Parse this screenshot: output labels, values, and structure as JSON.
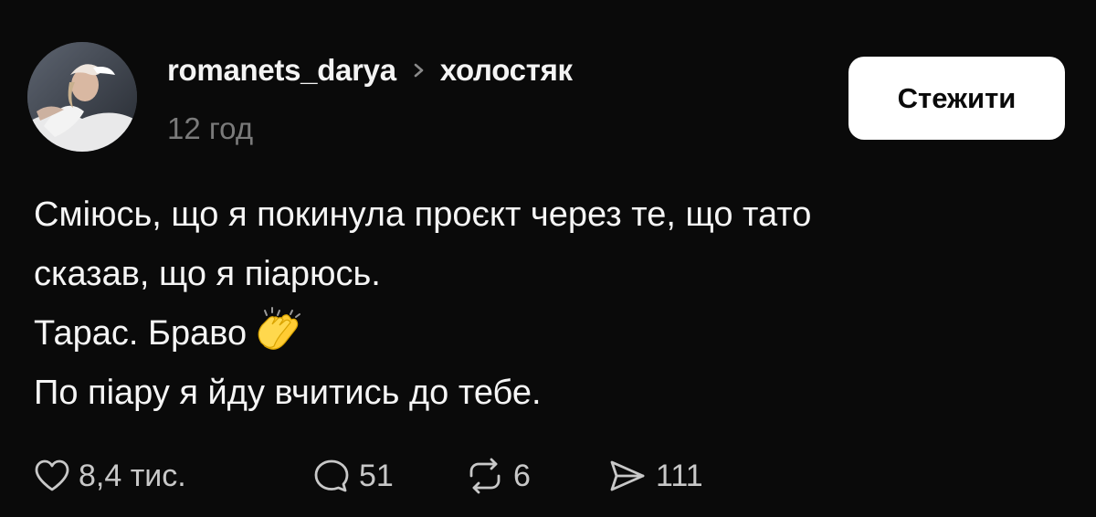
{
  "post": {
    "username": "romanets_darya",
    "community": "холостяк",
    "timestamp": "12 год",
    "follow_label": "Стежити",
    "lines": [
      "Сміюсь, що я покинула проєкт через те, що тато",
      "сказав, що я піарюсь.",
      "Тарас. Браво",
      "По піару я йду вчитись до тебе."
    ],
    "emoji": "clapping-hands"
  },
  "actions": {
    "likes": "8,4 тис.",
    "comments": "51",
    "reposts": "6",
    "shares": "111"
  },
  "colors": {
    "background": "#0a0a0a",
    "text": "#f5f5f5",
    "muted": "#7a7a7a",
    "button_bg": "#ffffff",
    "button_text": "#0a0a0a"
  }
}
